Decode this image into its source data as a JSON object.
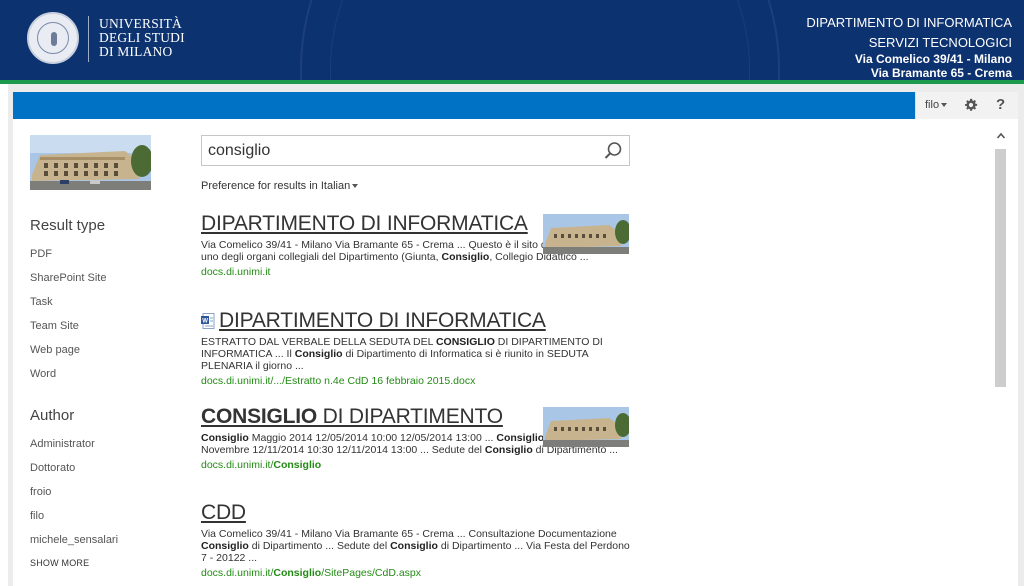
{
  "header": {
    "university_lines": [
      "UNIVERSITÀ",
      "DEGLI STUDI",
      "DI MILANO"
    ],
    "department": "DIPARTIMENTO DI INFORMATICA",
    "subtitle": "SERVIZI TECNOLOGICI",
    "address_1": "Via Comelico 39/41 - Milano",
    "address_2": "Via Bramante 65 - Crema",
    "logo_icon": "university-seal-icon"
  },
  "suitebar": {
    "user": "filo",
    "settings_icon": "gear-icon",
    "help_label": "?"
  },
  "search": {
    "query": "consiglio",
    "preference_prefix": "Preference for results in",
    "preference_language": "Italian"
  },
  "refiners": {
    "result_type_title": "Result type",
    "result_types": [
      "PDF",
      "SharePoint Site",
      "Task",
      "Team Site",
      "Web page",
      "Word"
    ],
    "author_title": "Author",
    "authors": [
      "Administrator",
      "Dottorato",
      "froio",
      "filo",
      "michele_sensalari"
    ],
    "show_more": "SHOW MORE"
  },
  "results": [
    {
      "title": "DIPARTIMENTO DI INFORMATICA",
      "desc_parts": [
        {
          "t": "Via Comelico 39/41 - Milano Via Bramante 65 - Crema ... Questo è il sito di gestione e ... di uno degli organi collegiali del Dipartimento (Giunta, "
        },
        {
          "t": "Consiglio",
          "b": true
        },
        {
          "t": ", Collegio Didattico ..."
        }
      ],
      "url_parts": [
        {
          "t": "docs.di.unimi.it"
        }
      ],
      "has_thumb": true,
      "has_word_icon": false
    },
    {
      "title": "DIPARTIMENTO DI INFORMATICA",
      "desc_parts": [
        {
          "t": "ESTRATTO DAL VERBALE DELLA SEDUTA DEL "
        },
        {
          "t": "CONSIGLIO",
          "b": true
        },
        {
          "t": " DI DIPARTIMENTO DI INFORMATICA ... Il "
        },
        {
          "t": "Consiglio",
          "b": true
        },
        {
          "t": " di Dipartimento di Informatica si è riunito in SEDUTA PLENARIA il giorno ..."
        }
      ],
      "url_parts": [
        {
          "t": "docs.di.unimi.it/.../Estratto n.4e CdD 16 febbraio 2015.docx"
        }
      ],
      "has_thumb": false,
      "has_word_icon": true
    },
    {
      "title_parts": [
        {
          "t": "CONSIGLIO",
          "b": true
        },
        {
          "t": " DI DIPARTIMENTO"
        }
      ],
      "desc_parts": [
        {
          "t": "Consiglio",
          "b": true
        },
        {
          "t": " Maggio 2014    12/05/2014 10:00 12/05/2014 13:00 ... "
        },
        {
          "t": "Consiglio",
          "b": true
        },
        {
          "t": " di Dipartimento di Novembre    12/11/2014 10:30 12/11/2014 13:00 ... Sedute del "
        },
        {
          "t": "Consiglio",
          "b": true
        },
        {
          "t": " di Dipartimento ..."
        }
      ],
      "url_parts": [
        {
          "t": "docs.di.unimi.it/"
        },
        {
          "t": "Consiglio",
          "b": true
        }
      ],
      "has_thumb": true,
      "has_word_icon": false
    },
    {
      "title": "CDD",
      "desc_parts": [
        {
          "t": "Via Comelico 39/41 - Milano Via Bramante 65 - Crema ... Consultazione Documentazione "
        },
        {
          "t": "Consiglio",
          "b": true
        },
        {
          "t": " di Dipartimento ... Sedute del "
        },
        {
          "t": "Consiglio",
          "b": true
        },
        {
          "t": " di Dipartimento ... Via Festa del Perdono 7 - 20122 ..."
        }
      ],
      "url_parts": [
        {
          "t": "docs.di.unimi.it/"
        },
        {
          "t": "Consiglio",
          "b": true
        },
        {
          "t": "/SitePages/CdD.aspx"
        }
      ],
      "has_thumb": false,
      "has_word_icon": false
    }
  ],
  "colors": {
    "banner": "#0d3270",
    "suitebar": "#0072c6",
    "accent_line": "#1d9b4c",
    "url_green": "#238b15"
  }
}
